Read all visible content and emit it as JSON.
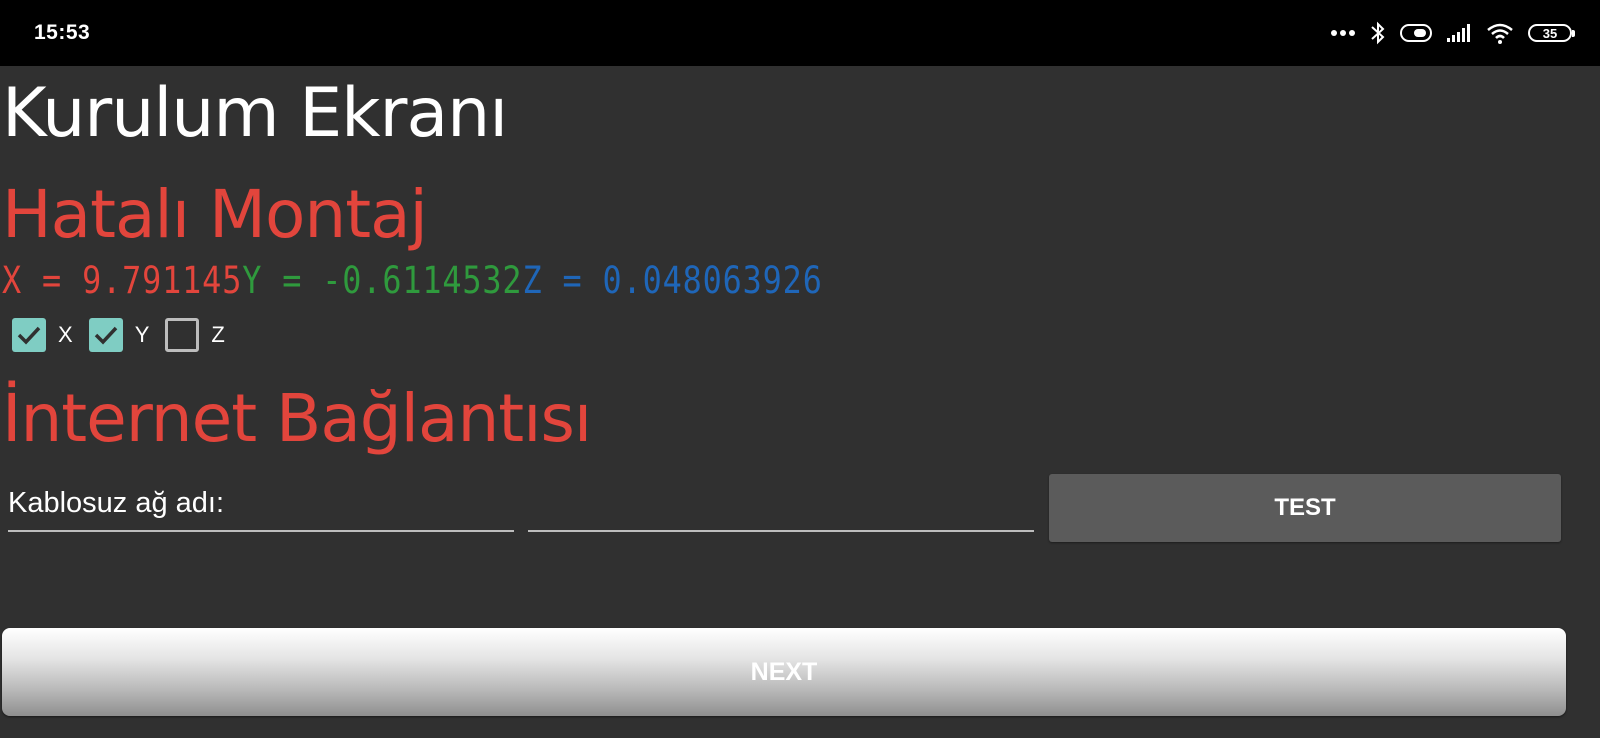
{
  "status_bar": {
    "time": "15:53",
    "icons": [
      "more-icon",
      "bluetooth-icon",
      "toggle-icon",
      "signal-icon",
      "wifi-icon",
      "battery-icon"
    ],
    "battery_level": "35"
  },
  "page": {
    "title": "Kurulum Ekranı"
  },
  "montaj": {
    "heading": "Hatalı Montaj",
    "heading_color": "#e2453c",
    "sensor": {
      "x_text": "X = 9.791145",
      "y_text": "Y = -0.6114532",
      "z_text": "Z = 0.048063926",
      "x_color": "#e2453c",
      "y_color": "#2f9a3d",
      "z_color": "#1f66b8"
    },
    "axes_checks": [
      {
        "label": "X",
        "checked": true
      },
      {
        "label": "Y",
        "checked": true
      },
      {
        "label": "Z",
        "checked": false
      }
    ]
  },
  "internet": {
    "heading": "İnternet Bağlantısı",
    "ssid_value": "Kablosuz ağ adı:",
    "password_value": "",
    "test_label": "TEST"
  },
  "footer": {
    "next_label": "NEXT"
  },
  "colors": {
    "background": "#303030",
    "accent_check": "#7fcdc3",
    "button_gray": "#5b5b5b"
  }
}
